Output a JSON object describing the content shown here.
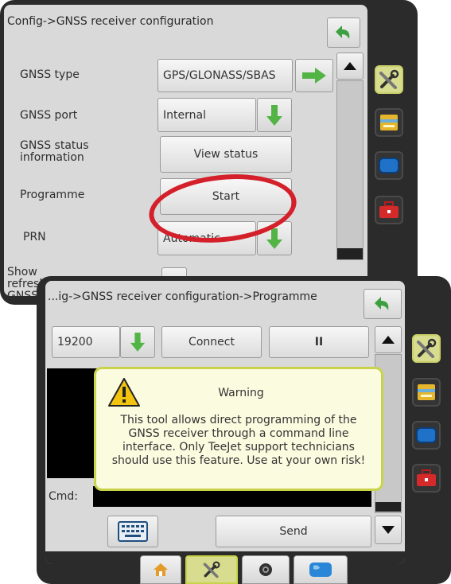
{
  "back_panel": {
    "title": "Config->GNSS receiver configuration",
    "rows": [
      {
        "label": "GNSS type",
        "value": "GPS/GLONASS/SBAS"
      },
      {
        "label": "GNSS port",
        "value": "Internal"
      },
      {
        "label": "GNSS status information",
        "value": "View status"
      },
      {
        "label": "Programme",
        "value": "Start"
      },
      {
        "label": "PRN",
        "value": "Automatic"
      },
      {
        "label": "Show refresh GNSS",
        "value": ""
      }
    ]
  },
  "front_panel": {
    "title": "...ig->GNSS receiver configuration->Programme",
    "baud_value": "19200",
    "connect_label": "Connect",
    "pause_label": "II",
    "cmd_label": "Cmd:",
    "send_label": "Send",
    "warning": {
      "title": "Warning",
      "message": "This tool allows direct programming of the GNSS receiver through a command line interface. Only TeeJet support technicians should use this feature. Use at your own risk!"
    }
  },
  "icons": [
    "back-arrow-icon",
    "green-right-arrow-icon",
    "green-down-arrow-icon",
    "up-arrow-icon",
    "down-arrow-icon",
    "tools-icon",
    "machine-icon",
    "screen-icon",
    "toolbox-icon",
    "home-icon",
    "camera-icon",
    "globe-icon",
    "keyboard-icon",
    "warning-icon"
  ],
  "colors": {
    "highlight": "#c9d34a",
    "warning_bg": "#fbfbe0",
    "red_ring": "#d4202a",
    "green_arrow": "#53b446"
  }
}
